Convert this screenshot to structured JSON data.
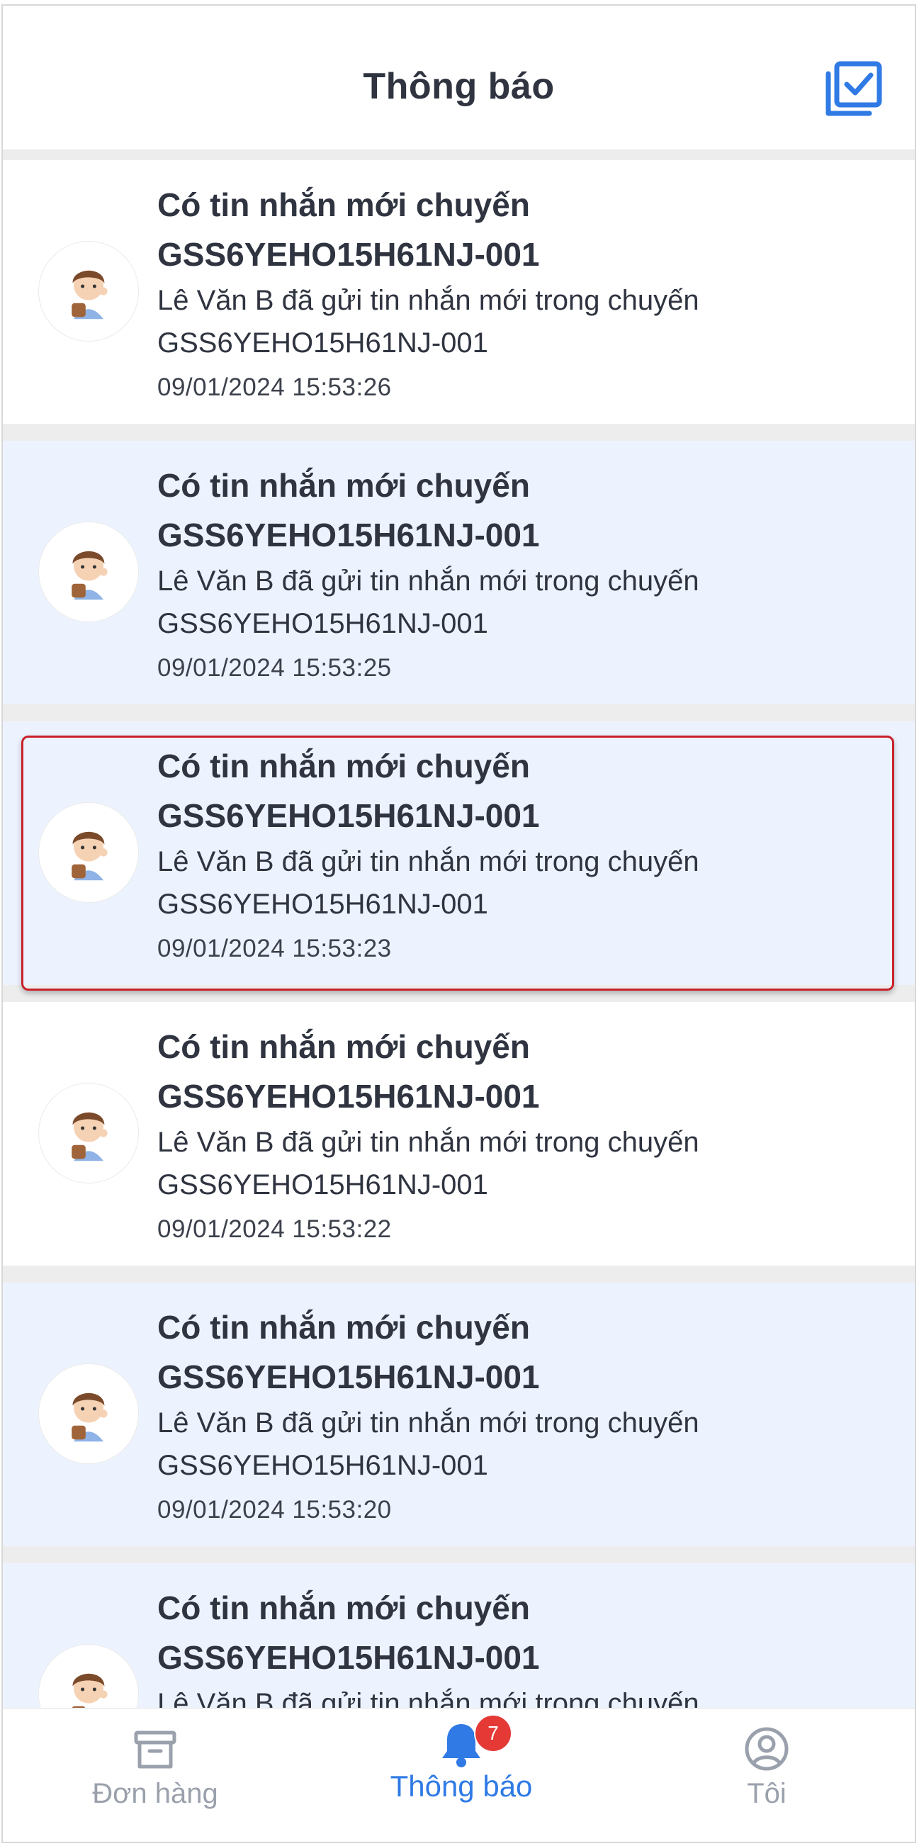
{
  "header": {
    "title": "Thông báo",
    "action_icon": "mark-all-read-icon"
  },
  "notifications": [
    {
      "title": "Có tin nhắn mới chuyến GSS6YEHO15H61NJ-001",
      "body": "Lê Văn B đã gửi tin nhắn mới trong chuyến GSS6YEHO15H61NJ-001",
      "time": "09/01/2024 15:53:26",
      "unread": false
    },
    {
      "title": "Có tin nhắn mới chuyến GSS6YEHO15H61NJ-001",
      "body": "Lê Văn B đã gửi tin nhắn mới trong chuyến GSS6YEHO15H61NJ-001",
      "time": "09/01/2024 15:53:25",
      "unread": true
    },
    {
      "title": "Có tin nhắn mới chuyến GSS6YEHO15H61NJ-001",
      "body": "Lê Văn B đã gửi tin nhắn mới trong chuyến GSS6YEHO15H61NJ-001",
      "time": "09/01/2024 15:53:23",
      "unread": true
    },
    {
      "title": "Có tin nhắn mới chuyến GSS6YEHO15H61NJ-001",
      "body": "Lê Văn B đã gửi tin nhắn mới trong chuyến GSS6YEHO15H61NJ-001",
      "time": "09/01/2024 15:53:22",
      "unread": false
    },
    {
      "title": "Có tin nhắn mới chuyến GSS6YEHO15H61NJ-001",
      "body": "Lê Văn B đã gửi tin nhắn mới trong chuyến GSS6YEHO15H61NJ-001",
      "time": "09/01/2024 15:53:20",
      "unread": true
    },
    {
      "title": "Có tin nhắn mới chuyến GSS6YEHO15H61NJ-001",
      "body": "Lê Văn B đã gửi tin nhắn mới trong chuyến",
      "time": "",
      "unread": true
    }
  ],
  "tabbar": {
    "tabs": [
      {
        "label": "Đơn hàng",
        "icon": "archive-box-icon",
        "active": false
      },
      {
        "label": "Thông báo",
        "icon": "bell-icon",
        "active": true,
        "badge": "7"
      },
      {
        "label": "Tôi",
        "icon": "user-circle-icon",
        "active": false
      }
    ]
  },
  "colors": {
    "accent": "#2f7ae5",
    "unread_bg": "#edf3fe",
    "badge": "#e53935",
    "selection_border": "#c8202a"
  }
}
